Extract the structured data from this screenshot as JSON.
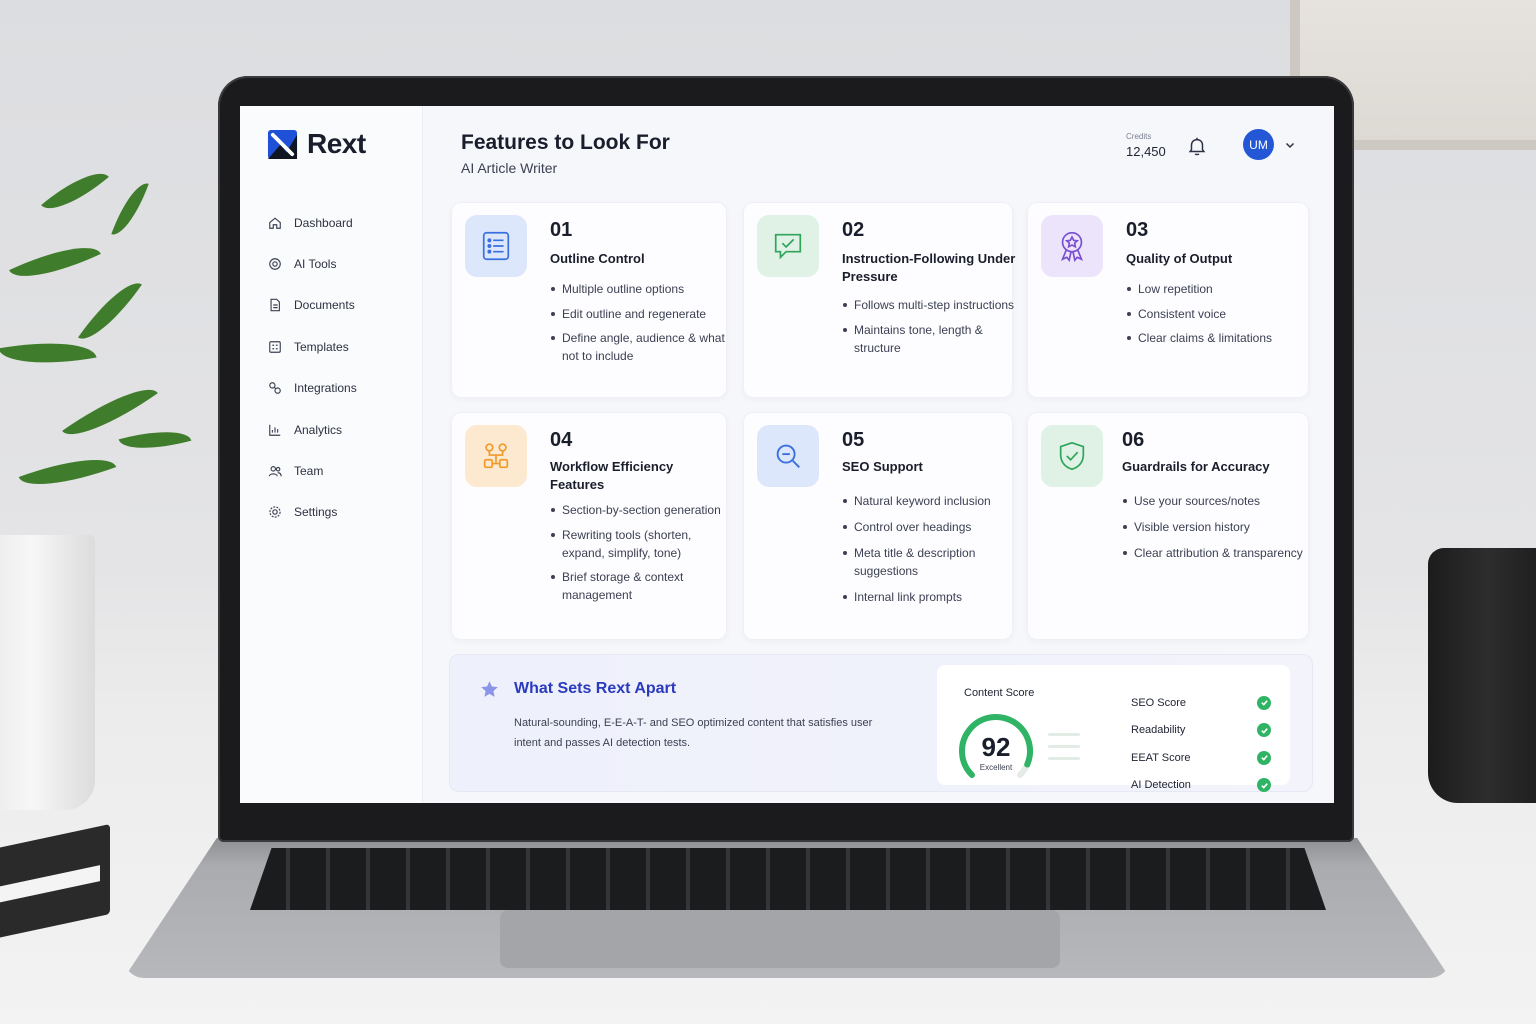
{
  "brand": {
    "name": "Rext",
    "accent": "#2457d6"
  },
  "sidebar": {
    "items": [
      {
        "label": "Dashboard",
        "icon": "home-icon"
      },
      {
        "label": "AI Tools",
        "icon": "target-icon"
      },
      {
        "label": "Documents",
        "icon": "document-icon"
      },
      {
        "label": "Templates",
        "icon": "templates-icon"
      },
      {
        "label": "Integrations",
        "icon": "integrations-icon"
      },
      {
        "label": "Analytics",
        "icon": "analytics-icon"
      },
      {
        "label": "Team",
        "icon": "team-icon"
      },
      {
        "label": "Settings",
        "icon": "gear-icon"
      }
    ]
  },
  "header": {
    "title": "Features to Look For",
    "subtitle": "AI Article Writer",
    "credits_label": "Credits",
    "credits_value": "12,450",
    "avatar_initials": "UM"
  },
  "features": [
    {
      "num": "01",
      "title": "Outline Control",
      "icon": "outline-list-icon",
      "color": "#3b6fe0",
      "bullets": [
        "Multiple outline options",
        "Edit outline and regenerate",
        "Define angle, audience & what not to include"
      ]
    },
    {
      "num": "02",
      "title": "Instruction-Following Under Pressure",
      "icon": "chat-check-icon",
      "color": "#2fa55a",
      "bullets": [
        "Follows multi-step instructions",
        "Maintains tone, length & structure"
      ]
    },
    {
      "num": "03",
      "title": "Quality of Output",
      "icon": "award-badge-icon",
      "color": "#7a4fd1",
      "bullets": [
        "Low repetition",
        "Consistent voice",
        "Clear claims & limitations"
      ]
    },
    {
      "num": "04",
      "title": "Workflow Efficiency Features",
      "icon": "workflow-icon",
      "color": "#ee9a2c",
      "bullets": [
        "Section-by-section generation",
        "Rewriting tools (shorten, expand, simplify, tone)",
        "Brief storage & context management"
      ]
    },
    {
      "num": "05",
      "title": "SEO Support",
      "icon": "search-zoom-icon",
      "color": "#3b6fe0",
      "bullets": [
        "Natural keyword inclusion",
        "Control over headings",
        "Meta title & description suggestions",
        "Internal link prompts"
      ]
    },
    {
      "num": "06",
      "title": "Guardrails for Accuracy",
      "icon": "shield-check-icon",
      "color": "#2fa55a",
      "bullets": [
        "Use your sources/notes",
        "Visible version history",
        "Clear attribution & transparency"
      ]
    }
  ],
  "apart": {
    "title": "What Sets Rext Apart",
    "text": "Natural-sounding, E-E-A-T- and SEO optimized content that satisfies user intent and passes AI detection tests."
  },
  "score": {
    "title": "Content Score",
    "value": 92,
    "max": 100,
    "rating": "Excellent",
    "checks": [
      {
        "label": "SEO Score",
        "status": "pass"
      },
      {
        "label": "Readability",
        "status": "pass"
      },
      {
        "label": "EEAT Score",
        "status": "pass"
      },
      {
        "label": "AI Detection",
        "status": "pass"
      }
    ]
  }
}
